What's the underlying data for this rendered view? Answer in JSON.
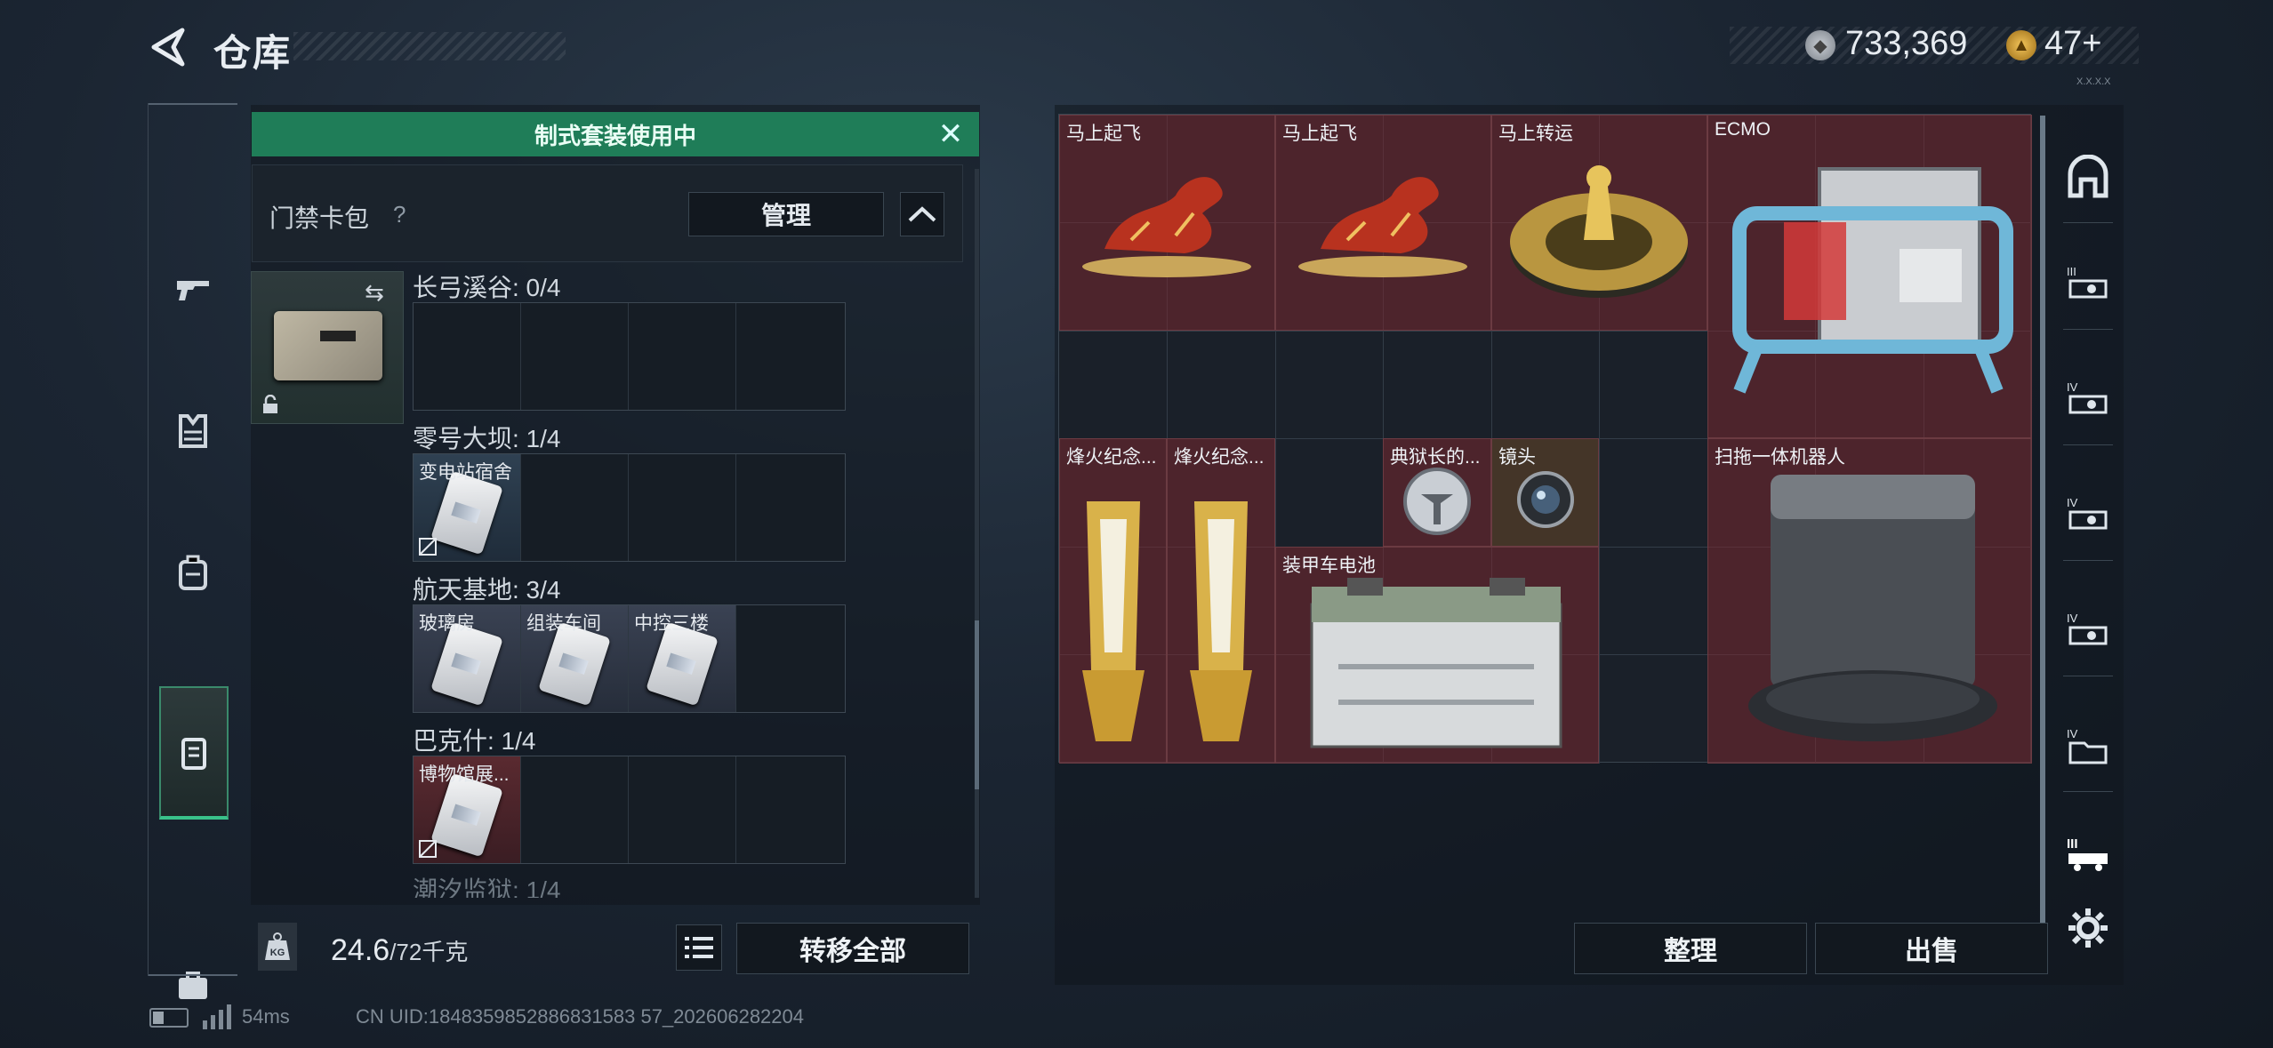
{
  "header": {
    "title": "仓库",
    "cash": "733,369",
    "coins": "47+",
    "version": "X.X.X.X"
  },
  "left_nav": {
    "items": [
      "gun-icon",
      "vest-icon",
      "backpack-icon",
      "bag-icon",
      "card-case-icon",
      "briefcase-icon"
    ],
    "active": "card-case-icon"
  },
  "container": {
    "banner": "制式套装使用中",
    "card_pack_label": "门禁卡包",
    "help": "?",
    "manage_label": "管理",
    "sections": [
      {
        "title": "长弓溪谷: 0/4",
        "cards": []
      },
      {
        "title": "零号大坝: 1/4",
        "cards": [
          {
            "name": "变电站宿舍",
            "color": "blue"
          }
        ]
      },
      {
        "title": "航天基地: 3/4",
        "cards": [
          {
            "name": "玻璃房",
            "color": "purple"
          },
          {
            "name": "组装车间",
            "color": "purple"
          },
          {
            "name": "中控三楼",
            "color": "purple"
          }
        ]
      },
      {
        "title": "巴克什: 1/4",
        "cards": [
          {
            "name": "博物馆展...",
            "color": "red"
          }
        ]
      },
      {
        "title": "潮汐监狱: 1/4"
      }
    ],
    "weight": "24.6",
    "weight_max": "/72千克",
    "kg_icon": "KG",
    "transfer_all_label": "转移全部"
  },
  "stash": {
    "items": [
      {
        "name": "马上起飞",
        "icon": "red-horse-statue"
      },
      {
        "name": "马上起飞",
        "icon": "red-horse-statue"
      },
      {
        "name": "马上转运",
        "icon": "gold-horse-coin"
      },
      {
        "name": "ECMO",
        "icon": "ecmo-machine"
      },
      {
        "name": "烽火纪念...",
        "icon": "gold-trophy"
      },
      {
        "name": "烽火纪念...",
        "icon": "gold-trophy"
      },
      {
        "name": "典狱长的...",
        "icon": "silver-badge"
      },
      {
        "name": "镜头",
        "icon": "camera-lens"
      },
      {
        "name": "扫拖一体机器人",
        "icon": "robot-vacuum-station"
      },
      {
        "name": "装甲车电池",
        "icon": "vehicle-battery"
      }
    ],
    "sort_label": "整理",
    "sell_label": "出售"
  },
  "right_nav": {
    "items": [
      "shelter-icon",
      "tier-iii-weapon-icon",
      "tier-iv-weapon-icon",
      "tier-iv-weapon-icon",
      "tier-iv-weapon-icon",
      "tier-iv-folder-icon",
      "tier-iii-vehicle-icon",
      "settings-icon"
    ]
  },
  "status": {
    "ping": "54ms",
    "uid": "CN UID:1848359852886831583 57_202606282204"
  }
}
